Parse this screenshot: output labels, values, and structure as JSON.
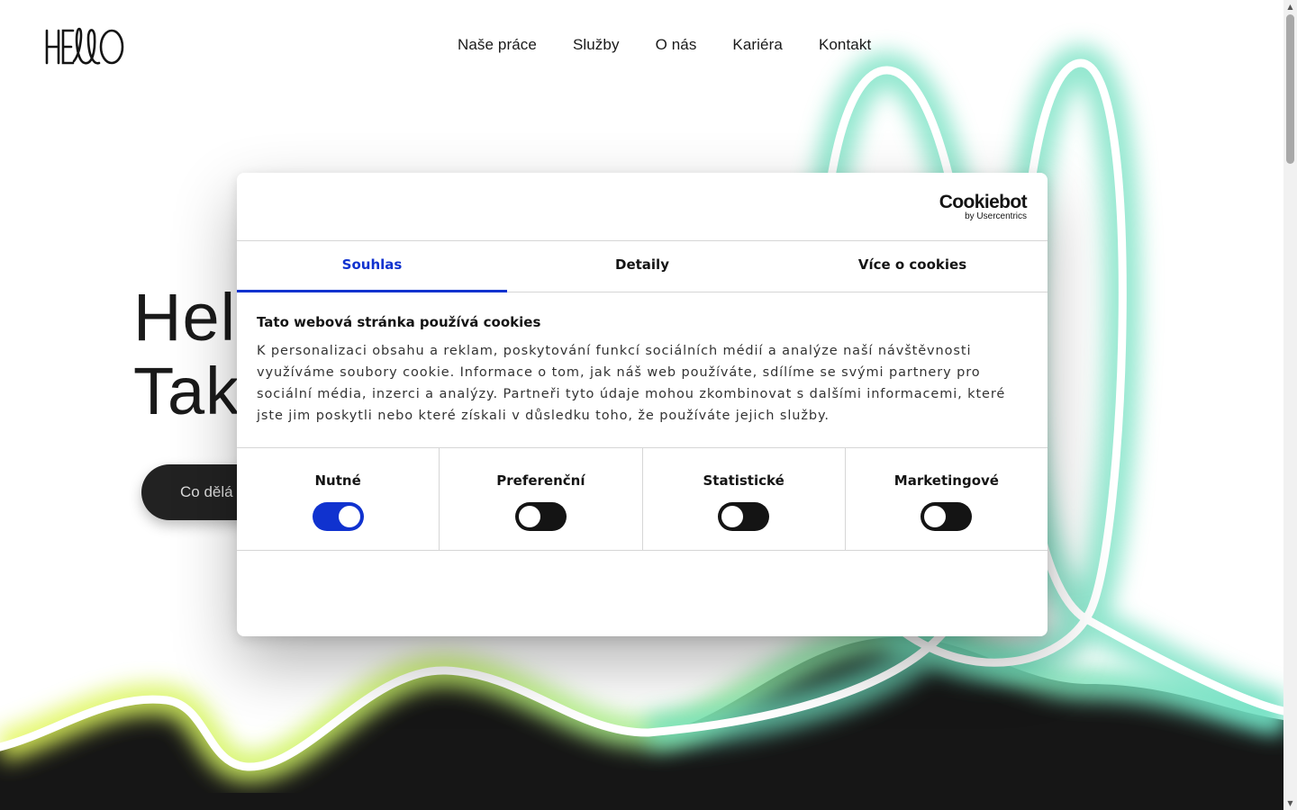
{
  "brand": {
    "logo_text": "HELLO"
  },
  "nav": {
    "items": [
      {
        "label": "Naše práce"
      },
      {
        "label": "Služby"
      },
      {
        "label": "O nás"
      },
      {
        "label": "Kariéra"
      },
      {
        "label": "Kontakt"
      }
    ]
  },
  "hero": {
    "title_line1": "Hel",
    "title_line2": "Tak",
    "cta_label": "Co dělá"
  },
  "cookie_dialog": {
    "brand_main": "Cookiebot",
    "brand_sub": "by Usercentrics",
    "tabs": [
      {
        "label": "Souhlas",
        "active": true
      },
      {
        "label": "Detaily",
        "active": false
      },
      {
        "label": "Více o cookies",
        "active": false
      }
    ],
    "heading": "Tato webová stránka používá cookies",
    "description": "K personalizaci obsahu a reklam, poskytování funkcí sociálních médií a analýze naší návštěvnosti využíváme soubory cookie. Informace o tom, jak náš web používáte, sdílíme se svými partnery pro sociální média, inzerci a analýzy. Partneři tyto údaje mohou zkombinovat s dalšími informacemi, které jste jim poskytli nebo které získali v důsledku toho, že používáte jejich služby.",
    "categories": [
      {
        "label": "Nutné",
        "enabled": true
      },
      {
        "label": "Preferenční",
        "enabled": false
      },
      {
        "label": "Statistické",
        "enabled": false
      },
      {
        "label": "Marketingové",
        "enabled": false
      }
    ]
  },
  "colors": {
    "accent": "#1032cf",
    "glow_green": "#6ee8b0",
    "glow_yellow": "#d8f55a",
    "dark": "#141414"
  }
}
